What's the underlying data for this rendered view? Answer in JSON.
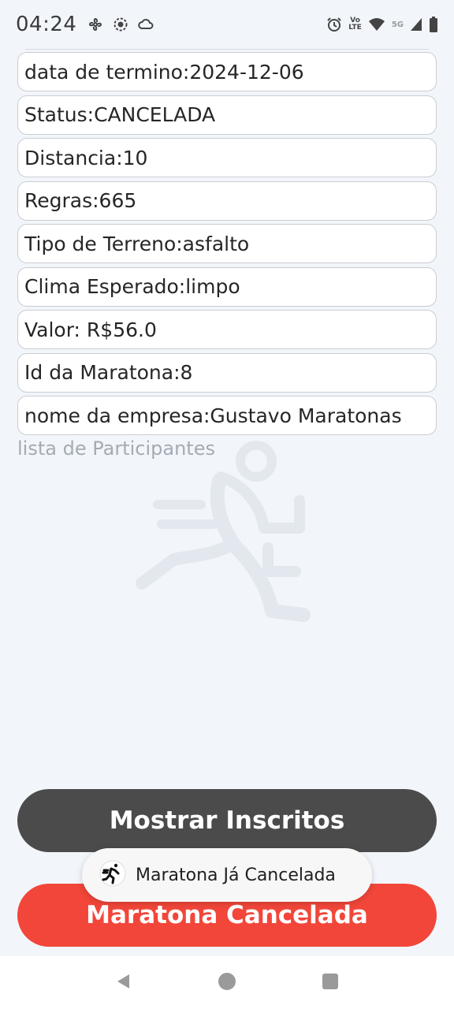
{
  "status_bar": {
    "time": "04:24",
    "left_icons": [
      "fan-icon",
      "record-icon",
      "cloud-icon"
    ],
    "right_icons": [
      "alarm-icon",
      "volte-icon",
      "wifi-icon",
      "5g-icon",
      "signal-icon",
      "battery-icon"
    ],
    "volte_top": "Vo",
    "volte_bottom": "LTE",
    "network_label": "5G"
  },
  "fields": [
    "data de termino:2024-12-06",
    "Status:CANCELADA",
    "Distancia:10",
    "Regras:665",
    "Tipo de Terreno:asfalto",
    "Clima Esperado:limpo",
    "Valor: R$56.0",
    "Id da Maratona:8",
    "nome da empresa:Gustavo Maratonas"
  ],
  "participants_label": "lista de Participantes",
  "buttons": {
    "show_label": "Mostrar Inscritos",
    "cancel_label": "Maratona Cancelada"
  },
  "toast": {
    "message": "Maratona Já Cancelada",
    "icon": "runner-app-icon"
  },
  "nav": {
    "back": "back-icon",
    "home": "home-icon",
    "recents": "recents-icon"
  },
  "colors": {
    "background": "#f2f6fb",
    "show_button": "#4b4b4b",
    "cancel_button": "#f2463a",
    "field_border": "#c9cdd2",
    "muted_label": "#a4abb3"
  }
}
